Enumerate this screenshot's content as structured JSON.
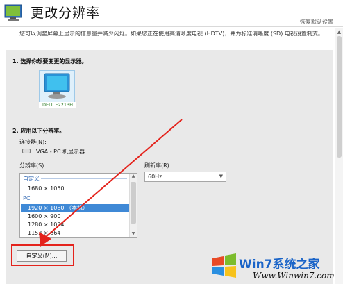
{
  "header": {
    "title": "更改分辨率",
    "restore_defaults": "恢复默认设置",
    "icon": "nvidia-display-icon"
  },
  "description": "您可以调整屏幕上显示的信息量并减少闪烁。如果您正在使用高清晰度电视 (HDTV)，并为标准清晰度 (SD) 电视设置制式。",
  "step1": {
    "label": "1. 选择你想要变更的显示器。",
    "monitor_caption": "DELL E2213H",
    "monitor_icon": "monitor-icon"
  },
  "step2": {
    "label": "2. 应用以下分辨率。",
    "connector_label": "连接器(N):",
    "connector_value": "VGA - PC 机显示器",
    "connector_icon": "vga-connector-icon",
    "resolution_label": "分辨率(S)",
    "refresh_label": "刷新率(R):",
    "refresh_value": "60Hz",
    "groups": [
      {
        "name": "自定义",
        "items": [
          "1680 × 1050"
        ]
      },
      {
        "name": "PC",
        "items": [
          "1920 × 1080 （本机）",
          "1600 × 900",
          "1280 × 1024",
          "1152 × 864"
        ]
      }
    ],
    "selected_item": "1920 × 1080 （本机）",
    "custom_button": "自定义(M)..."
  },
  "watermark": {
    "text": "Win7系统之家",
    "url": "Www.Winwin7.com"
  },
  "colors": {
    "highlight": "#e4231c",
    "selection": "#3f89d6",
    "panel_bg": "#e9e9e9",
    "watermark_blue": "#1a64c8"
  }
}
